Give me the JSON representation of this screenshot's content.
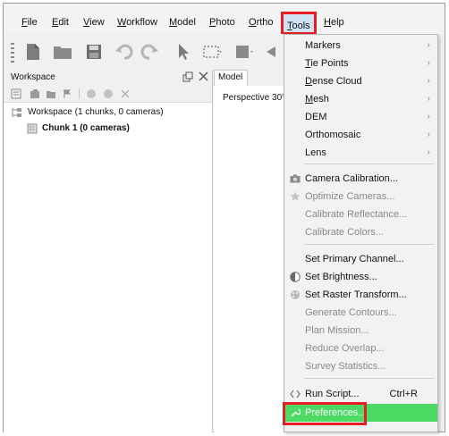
{
  "menubar": {
    "items": [
      {
        "label": "File",
        "u": "F",
        "rest": "ile"
      },
      {
        "label": "Edit",
        "u": "E",
        "rest": "dit"
      },
      {
        "label": "View",
        "u": "V",
        "rest": "iew"
      },
      {
        "label": "Workflow",
        "u": "W",
        "rest": "orkflow"
      },
      {
        "label": "Model",
        "u": "M",
        "rest": "odel"
      },
      {
        "label": "Photo",
        "u": "P",
        "rest": "hoto"
      },
      {
        "label": "Ortho",
        "u": "O",
        "rest": "rtho"
      },
      {
        "label": "Tools",
        "u": "T",
        "rest": "ools"
      },
      {
        "label": "Help",
        "u": "H",
        "rest": "elp"
      }
    ]
  },
  "workspace": {
    "title": "Workspace",
    "root": "Workspace (1 chunks, 0 cameras)",
    "chunk": "Chunk 1 (0 cameras)"
  },
  "model": {
    "tab": "Model",
    "view_label": "Perspective 30°"
  },
  "tools_menu": {
    "items": [
      {
        "label": "Markers",
        "submenu": true
      },
      {
        "label": "Tie Points",
        "submenu": true,
        "u": "T",
        "rest": "ie Points"
      },
      {
        "label": "Dense Cloud",
        "submenu": true,
        "u": "D",
        "rest": "ense Cloud"
      },
      {
        "label": "Mesh",
        "submenu": true,
        "u": "M",
        "rest": "esh"
      },
      {
        "label": "DEM",
        "submenu": true
      },
      {
        "label": "Orthomosaic",
        "submenu": true
      },
      {
        "label": "Lens",
        "submenu": true
      },
      {
        "label": "Camera Calibration..."
      },
      {
        "label": "Optimize Cameras..."
      },
      {
        "label": "Calibrate Reflectance..."
      },
      {
        "label": "Calibrate Colors..."
      },
      {
        "label": "Set Primary Channel..."
      },
      {
        "label": "Set Brightness..."
      },
      {
        "label": "Set Raster Transform..."
      },
      {
        "label": "Generate Contours..."
      },
      {
        "label": "Plan Mission..."
      },
      {
        "label": "Reduce Overlap..."
      },
      {
        "label": "Survey Statistics..."
      },
      {
        "label": "Run Script...",
        "shortcut": "Ctrl+R"
      },
      {
        "label": "Preferences..."
      }
    ],
    "highlight_color": "#4cd964",
    "callout_color": "#e51d24"
  }
}
